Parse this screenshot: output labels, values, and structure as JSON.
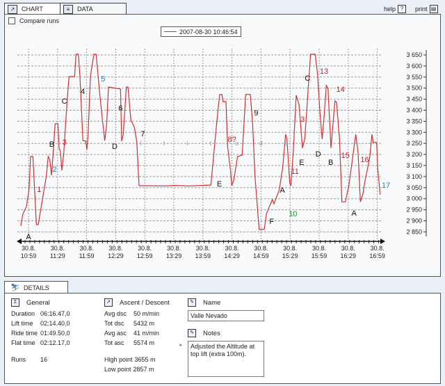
{
  "tabs": [
    {
      "label": "CHART",
      "icon": "chart-icon"
    },
    {
      "label": "DATA",
      "icon": "table-icon"
    }
  ],
  "toolbar": {
    "help": "help",
    "print": "print"
  },
  "compare_runs": {
    "label": "Compare runs",
    "checked": false
  },
  "chart_data": {
    "type": "line",
    "legend": [
      "2007-08-30 10:46:54"
    ],
    "line_color": "#d03030",
    "ylim": [
      2850,
      3650
    ],
    "yticks": [
      "3 650",
      "3 600",
      "3 550",
      "3 500",
      "3 450",
      "3 400",
      "3 350",
      "3 300",
      "3 250",
      "3 200",
      "3 150",
      "3 100",
      "3 050",
      "3 000",
      "2 950",
      "2 900",
      "2 850"
    ],
    "xticks": [
      {
        "date": "30.8.",
        "time": "10:59"
      },
      {
        "date": "30.8.",
        "time": "11:29"
      },
      {
        "date": "30.8.",
        "time": "11:59"
      },
      {
        "date": "30.8.",
        "time": "12:29"
      },
      {
        "date": "30.8.",
        "time": "12:59"
      },
      {
        "date": "30.8.",
        "time": "13:29"
      },
      {
        "date": "30.8.",
        "time": "13:59"
      },
      {
        "date": "30.8.",
        "time": "14:29"
      },
      {
        "date": "30.8.",
        "time": "14:59"
      },
      {
        "date": "30.8.",
        "time": "15:29"
      },
      {
        "date": "30.8.",
        "time": "15:59"
      },
      {
        "date": "30.8.",
        "time": "16:29"
      },
      {
        "date": "30.8.",
        "time": "16:59"
      }
    ],
    "grid": true,
    "series": [
      {
        "points": [
          [
            "10:51:06",
            2877
          ],
          [
            "10:53:03",
            2930
          ],
          [
            "10:56:50",
            2964
          ],
          [
            "10:59:30",
            3040
          ],
          [
            "11:01:09",
            3191
          ],
          [
            "11:03:31",
            3191
          ],
          [
            "11:06:00",
            2977
          ],
          [
            "11:07:07",
            2883
          ],
          [
            "11:09:03",
            2883
          ],
          [
            "11:12:38",
            2977
          ],
          [
            "11:17:27",
            3103
          ],
          [
            "11:19:18",
            3191
          ],
          [
            "11:21:02",
            3175
          ],
          [
            "11:22:41",
            3106
          ],
          [
            "11:24:07",
            3185
          ],
          [
            "11:26:29",
            3339
          ],
          [
            "11:29:21",
            3339
          ],
          [
            "11:30:35",
            3229
          ],
          [
            "11:31:48",
            3216
          ],
          [
            "11:33:27",
            3128
          ],
          [
            "11:35:23",
            3207
          ],
          [
            "11:38:58",
            3449
          ],
          [
            "11:40:50",
            3552
          ],
          [
            "11:46:35",
            3552
          ],
          [
            "11:48:01",
            3653
          ],
          [
            "11:50:28",
            3653
          ],
          [
            "11:52:07",
            3552
          ],
          [
            "11:53:46",
            3395
          ],
          [
            "11:55:12",
            3263
          ],
          [
            "11:58:04",
            3260
          ],
          [
            "11:59:18",
            3222
          ],
          [
            "12:00:31",
            3291
          ],
          [
            "12:02:54",
            3552
          ],
          [
            "12:06:29",
            3653
          ],
          [
            "12:08:50",
            3653
          ],
          [
            "12:12:00",
            3499
          ],
          [
            "12:14:52",
            3373
          ],
          [
            "12:17:44",
            3263
          ],
          [
            "12:19:36",
            3332
          ],
          [
            "12:21:32",
            3505
          ],
          [
            "12:33:57",
            3496
          ],
          [
            "12:35:10",
            3260
          ],
          [
            "12:36:49",
            3291
          ],
          [
            "12:39:58",
            3505
          ],
          [
            "12:41:37",
            3505
          ],
          [
            "12:44:42",
            3354
          ],
          [
            "12:48:18",
            3323
          ],
          [
            "12:50:44",
            3260
          ],
          [
            "12:53:06",
            3059
          ],
          [
            "13:20:00",
            3058
          ],
          [
            "13:29:00",
            3060
          ],
          [
            "13:45:00",
            3058
          ],
          [
            "14:07:15",
            3062
          ],
          [
            "14:10:08",
            3197
          ],
          [
            "14:14:26",
            3395
          ],
          [
            "14:16:22",
            3471
          ],
          [
            "14:18:44",
            3471
          ],
          [
            "14:19:45",
            3439
          ],
          [
            "14:22:50",
            3439
          ],
          [
            "14:24:29",
            3238
          ],
          [
            "14:27:38",
            3122
          ],
          [
            "14:28:47",
            3059
          ],
          [
            "14:30:43",
            3081
          ],
          [
            "14:34:48",
            3191
          ],
          [
            "14:39:33",
            3197
          ],
          [
            "14:43:08",
            3471
          ],
          [
            "14:47:57",
            3471
          ],
          [
            "14:50:19",
            3342
          ],
          [
            "14:52:45",
            3103
          ],
          [
            "14:57:04",
            2861
          ],
          [
            "15:02:19",
            2861
          ],
          [
            "15:04:41",
            2933
          ],
          [
            "15:10:43",
            2996
          ],
          [
            "15:12:22",
            2977
          ],
          [
            "15:17:53",
            3040
          ],
          [
            "15:21:28",
            3144
          ],
          [
            "15:24:20",
            3291
          ],
          [
            "15:25:46",
            3270
          ],
          [
            "15:28:38",
            3071
          ],
          [
            "15:29:47",
            3059
          ],
          [
            "15:32:14",
            3207
          ],
          [
            "15:35:19",
            3468
          ],
          [
            "15:38:11",
            3427
          ],
          [
            "15:41:46",
            3229
          ],
          [
            "15:44:08",
            3270
          ],
          [
            "15:47:43",
            3499
          ],
          [
            "15:50:10",
            3653
          ],
          [
            "15:54:54",
            3653
          ],
          [
            "15:57:21",
            3562
          ],
          [
            "15:59:43",
            3395
          ],
          [
            "16:02:05",
            3270
          ],
          [
            "16:04:32",
            3395
          ],
          [
            "16:06:24",
            3512
          ],
          [
            "16:08:07",
            3499
          ],
          [
            "16:11:12",
            3229
          ],
          [
            "16:15:17",
            3442
          ],
          [
            "16:16:56",
            3436
          ],
          [
            "16:20:01",
            3270
          ],
          [
            "16:22:28",
            2986
          ],
          [
            "16:26:03",
            2986
          ],
          [
            "16:29:38",
            3059
          ],
          [
            "16:36:50",
            3291
          ],
          [
            "16:39:12",
            3207
          ],
          [
            "16:41:35",
            2986
          ],
          [
            "16:44:01",
            3018
          ],
          [
            "16:46:22",
            3081
          ],
          [
            "16:51:10",
            3185
          ],
          [
            "16:53:33",
            3291
          ],
          [
            "16:54:45",
            3254
          ],
          [
            "16:58:21",
            3254
          ],
          [
            "16:59:31",
            3134
          ],
          [
            "17:02:00",
            3018
          ]
        ]
      }
    ],
    "annotations": [
      {
        "text": "A",
        "color": "#111111",
        "time": "10:59",
        "alt": 2829
      },
      {
        "text": "1",
        "color": "#c0202a",
        "time": "11:10",
        "alt": 3043
      },
      {
        "text": "2",
        "color": "#2a78b8",
        "time": "11:26",
        "alt": 3134
      },
      {
        "text": "B",
        "color": "#111111",
        "time": "11:23",
        "alt": 3247
      },
      {
        "text": "3",
        "color": "#c0202a",
        "time": "11:36",
        "alt": 3257
      },
      {
        "text": "C",
        "color": "#111111",
        "time": "11:36",
        "alt": 3442
      },
      {
        "text": "4",
        "color": "#111111",
        "time": "11:55",
        "alt": 3486
      },
      {
        "text": "5",
        "color": "#2a78b8",
        "time": "12:16",
        "alt": 3543
      },
      {
        "text": "6",
        "color": "#111111",
        "time": "12:34",
        "alt": 3411
      },
      {
        "text": "D",
        "color": "#111111",
        "time": "12:28",
        "alt": 3238
      },
      {
        "text": "7",
        "color": "#111111",
        "time": "12:57",
        "alt": 3295
      },
      {
        "text": "8?",
        "color": "#c0202a",
        "time": "14:29",
        "alt": 3270
      },
      {
        "text": "9",
        "color": "#111111",
        "time": "14:54",
        "alt": 3389
      },
      {
        "text": "E",
        "color": "#111111",
        "time": "14:16",
        "alt": 3068
      },
      {
        "text": "F",
        "color": "#111111",
        "time": "15:10",
        "alt": 2898
      },
      {
        "text": "A",
        "color": "#111111",
        "time": "15:21",
        "alt": 3040
      },
      {
        "text": "10",
        "color": "#2a8a2a",
        "time": "15:32",
        "alt": 2933
      },
      {
        "text": "11",
        "color": "#c0202a",
        "time": "15:34",
        "alt": 3125
      },
      {
        "text": "E",
        "color": "#111111",
        "time": "15:41",
        "alt": 3166
      },
      {
        "text": "3",
        "color": "#c0202a",
        "time": "15:42",
        "alt": 3361
      },
      {
        "text": "C",
        "color": "#111111",
        "time": "15:47",
        "alt": 3546
      },
      {
        "text": "13",
        "color": "#c0202a",
        "time": "16:04",
        "alt": 3578
      },
      {
        "text": "14",
        "color": "#c0202a",
        "time": "16:21",
        "alt": 3496
      },
      {
        "text": "D",
        "color": "#111111",
        "time": "15:58",
        "alt": 3203
      },
      {
        "text": "B",
        "color": "#111111",
        "time": "16:11",
        "alt": 3166
      },
      {
        "text": "15",
        "color": "#c0202a",
        "time": "16:26",
        "alt": 3197
      },
      {
        "text": "16",
        "color": "#c0202a",
        "time": "16:46",
        "alt": 3178
      },
      {
        "text": "A",
        "color": "#111111",
        "time": "16:35",
        "alt": 2936
      },
      {
        "text": "17",
        "color": "#2a78b8",
        "time": "17:08",
        "alt": 3062
      },
      {
        "text": "l",
        "color": "#999999",
        "time": "12:55",
        "alt": 3254
      },
      {
        "text": "t",
        "color": "#999999",
        "time": "13:19",
        "alt": 3254
      },
      {
        "text": "i",
        "color": "#999999",
        "time": "13:43",
        "alt": 3254
      },
      {
        "text": "t",
        "color": "#999999",
        "time": "14:07",
        "alt": 3254
      },
      {
        "text": "u",
        "color": "#999999",
        "time": "14:34",
        "alt": 3254
      },
      {
        "text": "d",
        "color": "#999999",
        "time": "14:59",
        "alt": 3254
      },
      {
        "text": "e",
        "color": "#999999",
        "time": "15:25",
        "alt": 3254
      }
    ]
  },
  "details": {
    "tab_label": "DETAILS",
    "general": {
      "title": "General",
      "rows": [
        {
          "label": "Duration",
          "value": "06:16.47,0"
        },
        {
          "label": "Lift time",
          "value": "02:14.40,0"
        },
        {
          "label": "Ride time",
          "value": "01:49.50,0"
        },
        {
          "label": "Flat time",
          "value": "02:12.17,0"
        },
        {
          "label": "Runs",
          "value": "16"
        }
      ]
    },
    "ascent": {
      "title": "Ascent / Descent",
      "rows": [
        {
          "label": "Avg dsc",
          "value": "50 m/min"
        },
        {
          "label": "Tot dsc",
          "value": "5432 m"
        },
        {
          "label": "Avg asc",
          "value": "41 m/min"
        },
        {
          "label": "Tot asc",
          "value": "5574 m"
        },
        {
          "label": "High point",
          "value": "3655 m"
        },
        {
          "label": "Low point",
          "value": "2857 m"
        }
      ]
    },
    "name": {
      "title": "Name",
      "value": "Valle Nevado"
    },
    "notes": {
      "title": "Notes",
      "marker": "*",
      "value": "Adjusted the Altitude at top lift (extra 100m)."
    }
  }
}
